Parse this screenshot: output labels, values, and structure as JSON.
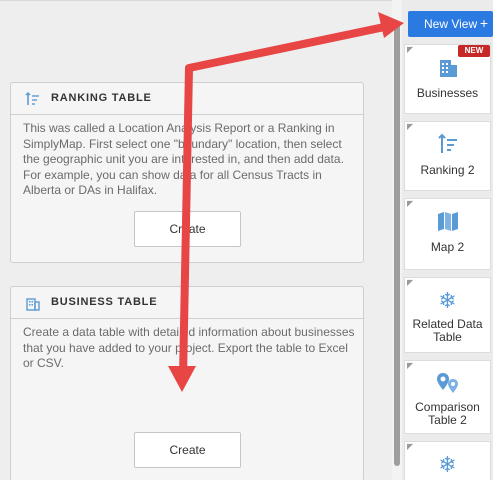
{
  "main": {
    "cards": [
      {
        "title": "RANKING TABLE",
        "description": "This was called a Location Analysis Report or a Ranking in SimplyMap. First select one \"boundary\" location, then select the geographic unit you are interested in, and then add data. For example, you can show data for all Census Tracts in Alberta or DAs in Halifax.",
        "button_label": "Create",
        "icon": "ranking-icon"
      },
      {
        "title": "BUSINESS TABLE",
        "description": "Create a data table with detailed information about businesses that you have added to your project. Export the table to Excel or CSV.",
        "button_label": "Create",
        "icon": "building-icon"
      }
    ]
  },
  "sidebar": {
    "new_view_label": "New View",
    "new_view_plus": "+",
    "new_badge": "NEW",
    "tiles": [
      {
        "label": "Businesses",
        "icon": "building-icon"
      },
      {
        "label": "Ranking 2",
        "icon": "ranking-icon"
      },
      {
        "label": "Map 2",
        "icon": "map-icon"
      },
      {
        "label": "Related Data Table",
        "icon": "snowflake-icon"
      },
      {
        "label": "Comparison Table 2",
        "icon": "location-pins-icon"
      },
      {
        "label": "",
        "icon": "snowflake-icon"
      }
    ]
  },
  "colors": {
    "accent": "#2a7ae2",
    "icon_blue": "#5b9bd5",
    "annotation_red": "#e84545",
    "badge_red": "#c62828"
  }
}
